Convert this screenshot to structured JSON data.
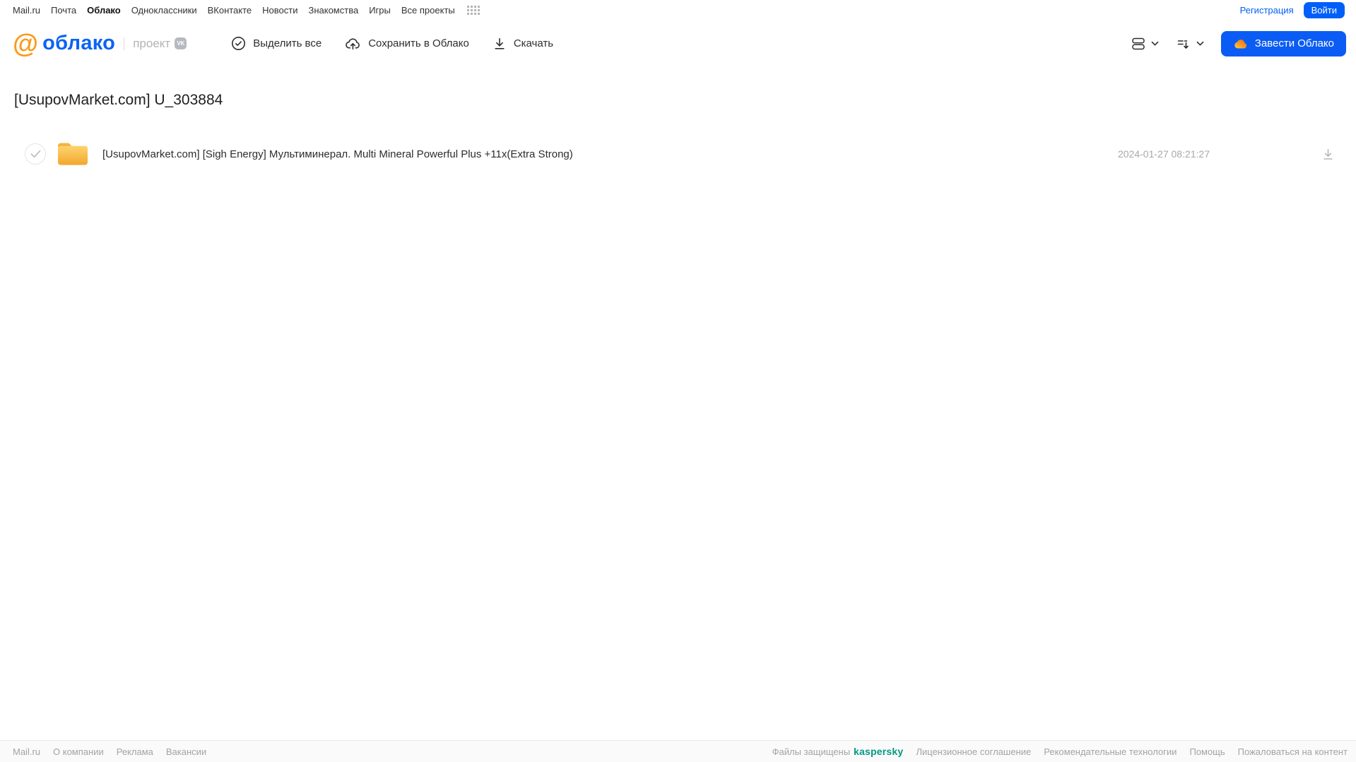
{
  "topnav": {
    "items": [
      {
        "label": "Mail.ru"
      },
      {
        "label": "Почта"
      },
      {
        "label": "Облако",
        "active": true
      },
      {
        "label": "Одноклассники"
      },
      {
        "label": "ВКонтакте"
      },
      {
        "label": "Новости"
      },
      {
        "label": "Знакомства"
      },
      {
        "label": "Игры"
      },
      {
        "label": "Все проекты"
      }
    ],
    "register_label": "Регистрация",
    "login_label": "Войти"
  },
  "header": {
    "logo_at": "@",
    "logo_text": "облако",
    "project_label": "проект",
    "vk_badge": "VK",
    "actions": [
      {
        "label": "Выделить все",
        "icon": "check-circle-icon"
      },
      {
        "label": "Сохранить в Облако",
        "icon": "cloud-upload-icon"
      },
      {
        "label": "Скачать",
        "icon": "download-icon"
      }
    ],
    "create_cloud_label": "Завести Облако"
  },
  "main": {
    "title": "[UsupovMarket.com] U_303884",
    "files": [
      {
        "type": "folder",
        "name": "[UsupovMarket.com] [Sigh Energy] Мультиминерал. Multi Mineral Powerful Plus +11x(Extra Strong)",
        "date": "2024-01-27 08:21:27"
      }
    ]
  },
  "footer": {
    "left_links": [
      "Mail.ru",
      "О компании",
      "Реклама",
      "Вакансии"
    ],
    "protected_text": "Файлы защищены",
    "kaspersky_label": "kaspersky",
    "right_links": [
      "Лицензионное соглашение",
      "Рекомендательные технологии",
      "Помощь",
      "Пожаловаться на контент"
    ]
  },
  "colors": {
    "brand_blue": "#005ff9",
    "logo_orange": "#f89c1c",
    "folder_top": "#ffd36e",
    "folder_bottom": "#f1a82f",
    "kaspersky_teal": "#009982",
    "footer_gray": "#a3a3a3"
  }
}
